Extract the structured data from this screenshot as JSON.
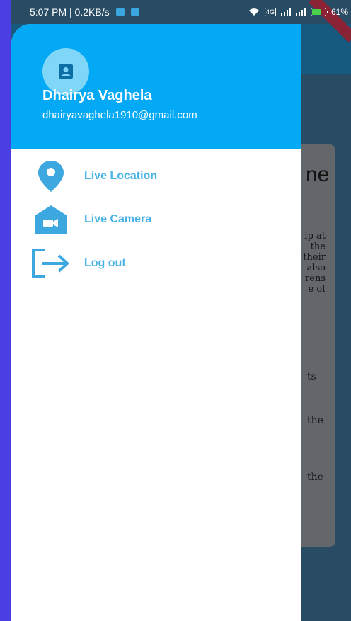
{
  "status_bar": {
    "time_speed": "5:07 PM | 0.2KB/s",
    "network_badge": "4G",
    "battery": "61%",
    "battery_level": 0.61
  },
  "drawer": {
    "user": {
      "name": "Dhairya Vaghela",
      "email": "dhairyavaghela1910@gmail.com",
      "avatar_icon": "account-box-icon"
    },
    "items": [
      {
        "label": "Live Location",
        "icon": "location-pin-icon"
      },
      {
        "label": "Live Camera",
        "icon": "camera-house-icon"
      },
      {
        "label": "Log out",
        "icon": "logout-icon"
      }
    ]
  },
  "background_page": {
    "title_fragment": "ne",
    "text_fragment": [
      "lp at",
      "the",
      "their",
      "also",
      "rens",
      "e of"
    ],
    "word_fragments": [
      "ts",
      "the",
      "the"
    ]
  },
  "colors": {
    "header": "#03a9f4",
    "menu_text": "#4ab3e6",
    "icon": "#3da7e0",
    "outer_background": "#4a3fe0"
  }
}
